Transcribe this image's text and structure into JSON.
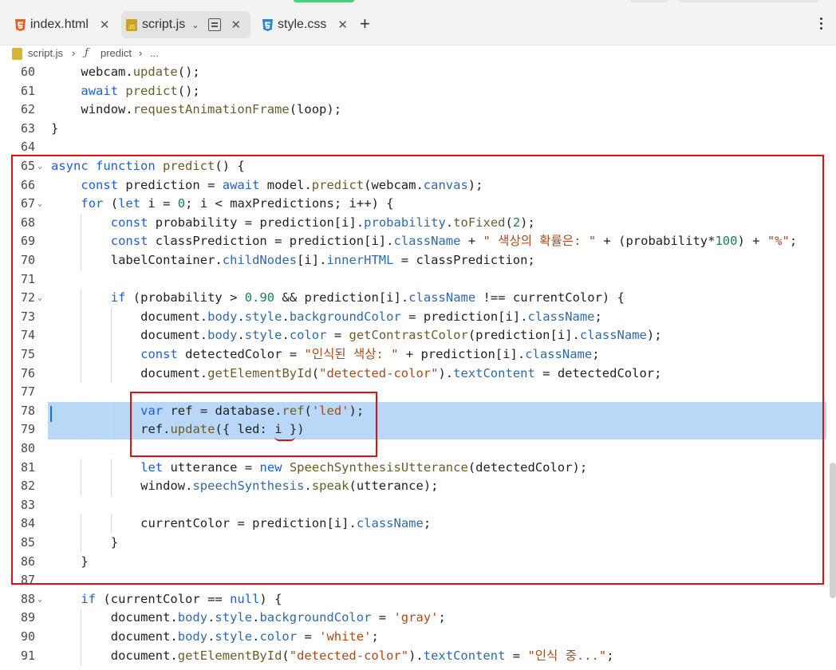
{
  "tabs": [
    {
      "label": "index.html",
      "icon": "html5-icon",
      "active": false
    },
    {
      "label": "script.js",
      "icon": "js-icon",
      "active": true
    },
    {
      "label": "style.css",
      "icon": "css3-icon",
      "active": false
    }
  ],
  "breadcrumb": {
    "file": "script.js",
    "symbol": "predict",
    "more": "..."
  },
  "colors": {
    "annotation_red": "#e01010",
    "selection_blue": "#b9d8f8",
    "keyword": "#1e5fd6",
    "string": "#a84a1a"
  },
  "code_lines": [
    {
      "n": "60",
      "text": "    webcam.update();"
    },
    {
      "n": "61",
      "text": "    await predict();"
    },
    {
      "n": "62",
      "text": "    window.requestAnimationFrame(loop);"
    },
    {
      "n": "63",
      "text": "}"
    },
    {
      "n": "64",
      "text": ""
    },
    {
      "n": "65",
      "text": "async function predict() {",
      "fold": true
    },
    {
      "n": "66",
      "text": "    const prediction = await model.predict(webcam.canvas);"
    },
    {
      "n": "67",
      "text": "    for (let i = 0; i < maxPredictions; i++) {",
      "fold": true
    },
    {
      "n": "68",
      "text": "        const probability = prediction[i].probability.toFixed(2);"
    },
    {
      "n": "69",
      "text": "        const classPrediction = prediction[i].className + \" 색상의 확률은: \" + (probability*100) + \"%\";"
    },
    {
      "n": "70",
      "text": "        labelContainer.childNodes[i].innerHTML = classPrediction;"
    },
    {
      "n": "71",
      "text": ""
    },
    {
      "n": "72",
      "text": "        if (probability > 0.90 && prediction[i].className !== currentColor) {",
      "fold": true
    },
    {
      "n": "73",
      "text": "            document.body.style.backgroundColor = prediction[i].className;"
    },
    {
      "n": "74",
      "text": "            document.body.style.color = getContrastColor(prediction[i].className);"
    },
    {
      "n": "75",
      "text": "            const detectedColor = \"인식된 색상: \" + prediction[i].className;"
    },
    {
      "n": "76",
      "text": "            document.getElementById(\"detected-color\").textContent = detectedColor;"
    },
    {
      "n": "77",
      "text": ""
    },
    {
      "n": "78",
      "text": "            var ref = database.ref('led');",
      "selected": true
    },
    {
      "n": "79",
      "text": "            ref.update({ led: i })",
      "selected": true
    },
    {
      "n": "80",
      "text": ""
    },
    {
      "n": "81",
      "text": "            let utterance = new SpeechSynthesisUtterance(detectedColor);"
    },
    {
      "n": "82",
      "text": "            window.speechSynthesis.speak(utterance);"
    },
    {
      "n": "83",
      "text": ""
    },
    {
      "n": "84",
      "text": "            currentColor = prediction[i].className;"
    },
    {
      "n": "85",
      "text": "        }"
    },
    {
      "n": "86",
      "text": "    }"
    },
    {
      "n": "87",
      "text": ""
    },
    {
      "n": "88",
      "text": "    if (currentColor == null) {",
      "fold": true
    },
    {
      "n": "89",
      "text": "        document.body.style.backgroundColor = 'gray';"
    },
    {
      "n": "90",
      "text": "        document.body.style.color = 'white';"
    },
    {
      "n": "91",
      "text": "        document.getElementById(\"detected-color\").textContent = \"인식 중...\";"
    }
  ]
}
